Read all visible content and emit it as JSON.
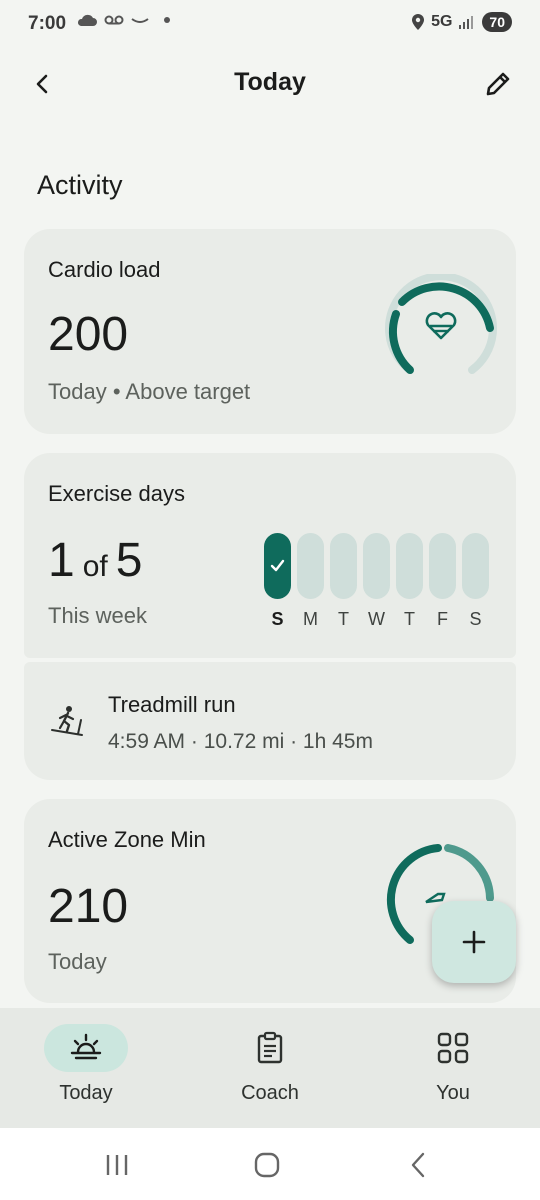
{
  "status_bar": {
    "time": "7:00",
    "network": "5G",
    "battery": "70"
  },
  "header": {
    "title": "Today"
  },
  "activity": {
    "section_title": "Activity",
    "cardio": {
      "label": "Cardio load",
      "value": "200",
      "subtitle": "Today • Above target",
      "ring_fill": 0.78
    },
    "exercise_days": {
      "label": "Exercise days",
      "done": "1",
      "of_text": "of",
      "goal": "5",
      "subtitle": "This week",
      "days": [
        {
          "letter": "S",
          "done": true
        },
        {
          "letter": "M",
          "done": false
        },
        {
          "letter": "T",
          "done": false
        },
        {
          "letter": "W",
          "done": false
        },
        {
          "letter": "T",
          "done": false
        },
        {
          "letter": "F",
          "done": false
        },
        {
          "letter": "S",
          "done": false
        }
      ]
    },
    "workout": {
      "name": "Treadmill run",
      "detail": "4:59 AM · 10.72 mi · 1h 45m"
    },
    "azm": {
      "label": "Active Zone Min",
      "value": "210",
      "subtitle": "Today"
    }
  },
  "bottom_nav": {
    "items": [
      {
        "label": "Today",
        "active": true
      },
      {
        "label": "Coach",
        "active": false
      },
      {
        "label": "You",
        "active": false
      }
    ]
  },
  "colors": {
    "accent": "#0f6b5c",
    "accent_light": "#cfe7e0",
    "card": "#e9ece8",
    "background": "#f3f5f2"
  }
}
